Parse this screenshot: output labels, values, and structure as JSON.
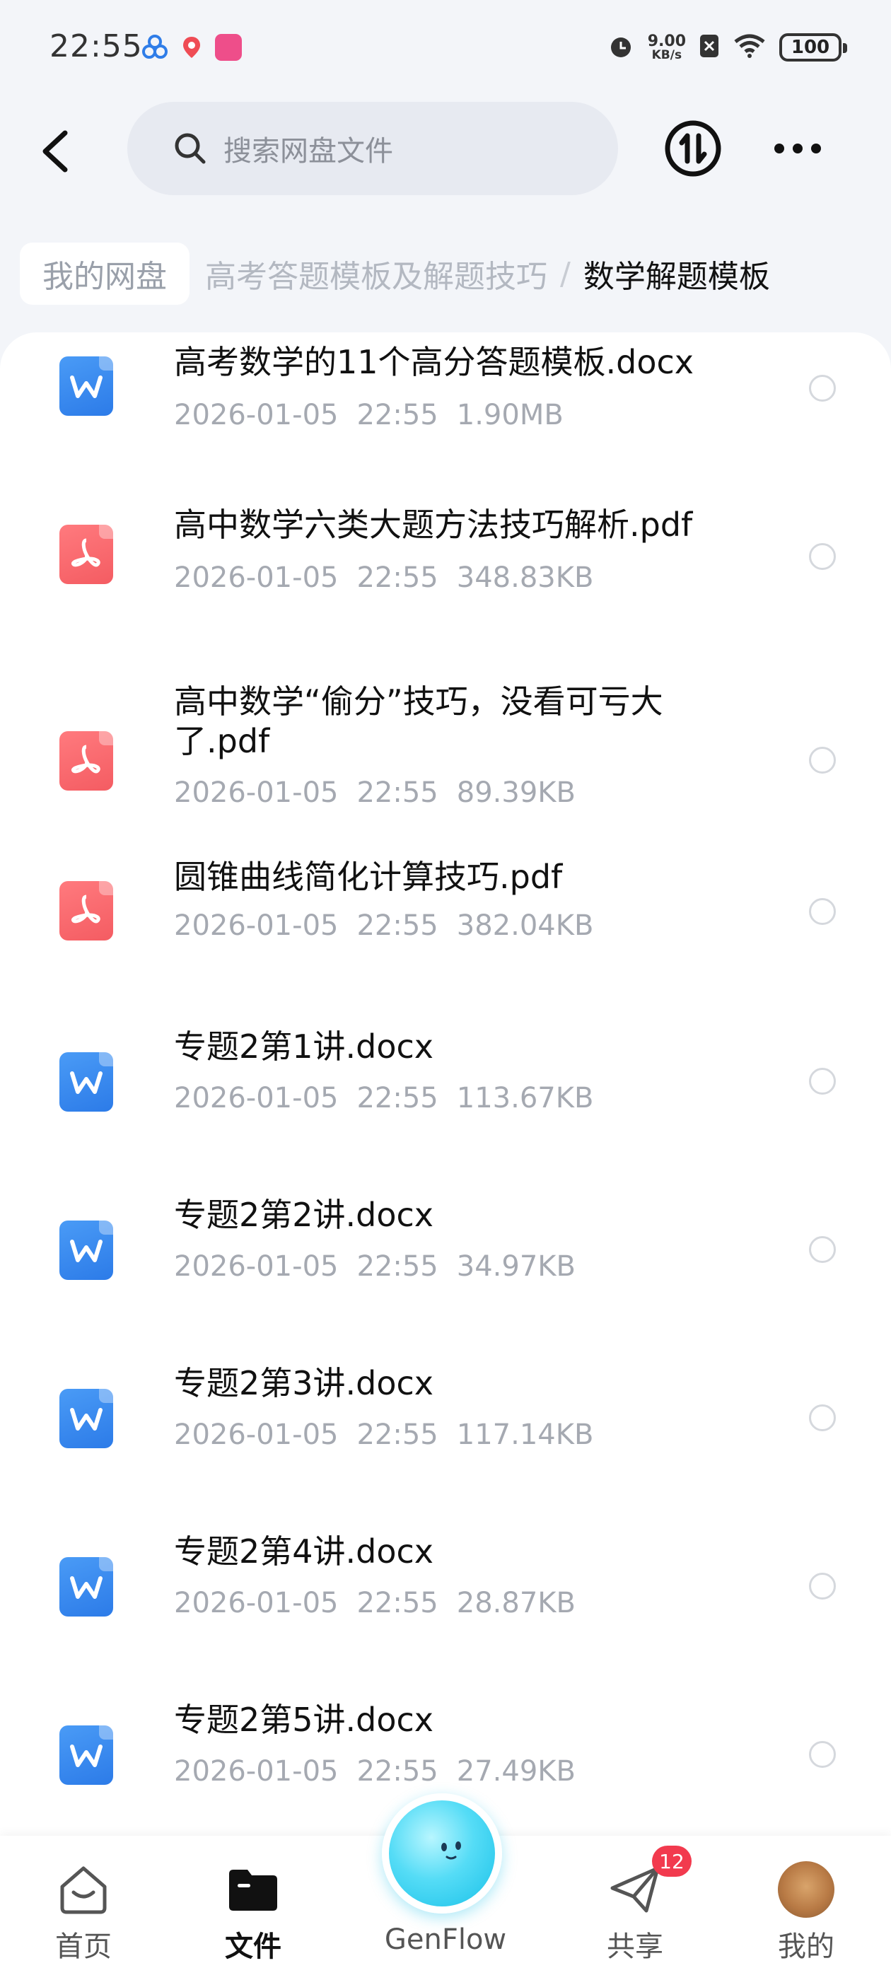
{
  "status_bar": {
    "time": "22:55",
    "net_speed_value": "9.00",
    "net_speed_unit": "KB/s",
    "battery": "100",
    "icons": [
      "alarm-icon",
      "no-sim-icon",
      "wifi-icon"
    ]
  },
  "header": {
    "search_placeholder": "搜索网盘文件",
    "icons": [
      "back-icon",
      "search-icon",
      "sort-icon",
      "more-icon"
    ]
  },
  "breadcrumb": {
    "root": "我的网盘",
    "parent": "高考答题模板及解题技巧",
    "separator": "/",
    "current": "数学解题模板"
  },
  "files": [
    {
      "name": "高考数学的11个高分答题模板.docx",
      "date": "2026-01-05",
      "time": "22:55",
      "size": "1.90MB",
      "type": "doc"
    },
    {
      "name": "高中数学六类大题方法技巧解析.pdf",
      "date": "2026-01-05",
      "time": "22:55",
      "size": "348.83KB",
      "type": "pdf"
    },
    {
      "name": "高中数学“偷分”技巧，没看可亏大了.pdf",
      "date": "2026-01-05",
      "time": "22:55",
      "size": "89.39KB",
      "type": "pdf"
    },
    {
      "name": "圆锥曲线简化计算技巧.pdf",
      "date": "2026-01-05",
      "time": "22:55",
      "size": "382.04KB",
      "type": "pdf"
    },
    {
      "name": "专题2第1讲.docx",
      "date": "2026-01-05",
      "time": "22:55",
      "size": "113.67KB",
      "type": "doc"
    },
    {
      "name": "专题2第2讲.docx",
      "date": "2026-01-05",
      "time": "22:55",
      "size": "34.97KB",
      "type": "doc"
    },
    {
      "name": "专题2第3讲.docx",
      "date": "2026-01-05",
      "time": "22:55",
      "size": "117.14KB",
      "type": "doc"
    },
    {
      "name": "专题2第4讲.docx",
      "date": "2026-01-05",
      "time": "22:55",
      "size": "28.87KB",
      "type": "doc"
    },
    {
      "name": "专题2第5讲.docx",
      "date": "2026-01-05",
      "time": "22:55",
      "size": "27.49KB",
      "type": "doc"
    }
  ],
  "bottom_nav": {
    "home": "首页",
    "files": "文件",
    "genflow": "GenFlow",
    "share": "共享",
    "share_badge": "12",
    "mine": "我的",
    "active": "files"
  },
  "colors": {
    "doc_icon": "#2c7be8",
    "pdf_icon": "#f45c62",
    "badge": "#f23a4e",
    "genflow": "#19c1e8"
  }
}
